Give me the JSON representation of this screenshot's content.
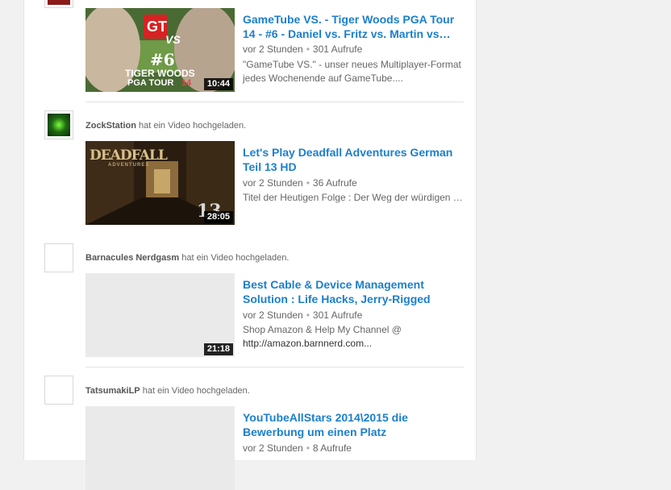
{
  "items": [
    {
      "uploader": "",
      "action": "",
      "title": "GameTube VS. - Tiger Woods PGA Tour 14 - #6 - Daniel vs. Fritz vs. Martin vs…",
      "time": "vor 2 Stunden",
      "views": "301 Aufrufe",
      "description": "\"GameTube VS.\" - unser neues Multiplayer-Format jedes Wochenende auf GameTube....",
      "duration": "10:44",
      "thumb_text": {
        "badge": "GT",
        "vs": "VS",
        "number": "#6",
        "game1": "TIGER WOODS",
        "game2": "PGA TOUR",
        "year": "14"
      }
    },
    {
      "uploader": "ZockStation",
      "action": "hat ein Video hochgeladen.",
      "title": "Let's Play Deadfall Adventures German Teil 13 HD",
      "time": "vor 2 Stunden",
      "views": "36 Aufrufe",
      "description": "Titel der Heutigen Folge : Der Weg der würdigen …",
      "duration": "28:05",
      "thumb_text": {
        "logo": "DEADFALL",
        "sub": "ADVENTURES",
        "episode": "13"
      }
    },
    {
      "uploader": "Barnacules Nerdgasm",
      "action": "hat ein Video hochgeladen.",
      "title": "Best Cable & Device Management Solution : Life Hacks, Jerry-Rigged",
      "time": "vor 2 Stunden",
      "views": "301 Aufrufe",
      "description": "Shop Amazon & Help My Channel @",
      "description_link": "http://amazon.barnnerd.com...",
      "duration": "21:18"
    },
    {
      "uploader": "TatsumakiLP",
      "action": "hat ein Video hochgeladen.",
      "title": "YouTubeAllStars 2014\\2015 die Bewerbung um einen Platz",
      "time": "vor 2 Stunden",
      "views": "8 Aufrufe"
    }
  ],
  "meta_separator": "•",
  "colors": {
    "title_link": "#1b7fcc",
    "meta_text": "#666666",
    "background": "#f1f1f1"
  }
}
